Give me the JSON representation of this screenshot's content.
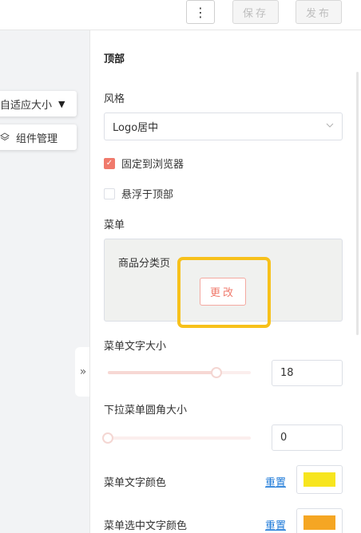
{
  "toolbar": {
    "more_label": "⋮",
    "save_label": "保存",
    "publish_label": "发布"
  },
  "canvas": {
    "size_label": "自适应大小",
    "components_label": "组件管理",
    "collapse_label": "»"
  },
  "panel": {
    "section_title": "顶部",
    "style_label": "风格",
    "style_value": "Logo居中",
    "fixed_checkbox": {
      "label": "固定到浏览器",
      "checked": true
    },
    "float_checkbox": {
      "label": "悬浮于顶部",
      "checked": false
    },
    "menu_label": "菜单",
    "menu_item": "商品分类页",
    "change_button": "更改",
    "font_size": {
      "label": "菜单文字大小",
      "value": "18",
      "slider_fraction": 0.76
    },
    "radius": {
      "label": "下拉菜单圆角大小",
      "value": "0",
      "slider_fraction": 0.0
    },
    "text_color": {
      "label": "菜单文字颜色",
      "reset": "重置",
      "color": "#f7e51e"
    },
    "selected_text_color": {
      "label": "菜单选中文字颜色",
      "reset": "重置",
      "color": "#f5a623"
    }
  },
  "colors": {
    "accent": "#f07a6c",
    "highlight": "#f7c11b",
    "link": "#1e7ad8"
  }
}
